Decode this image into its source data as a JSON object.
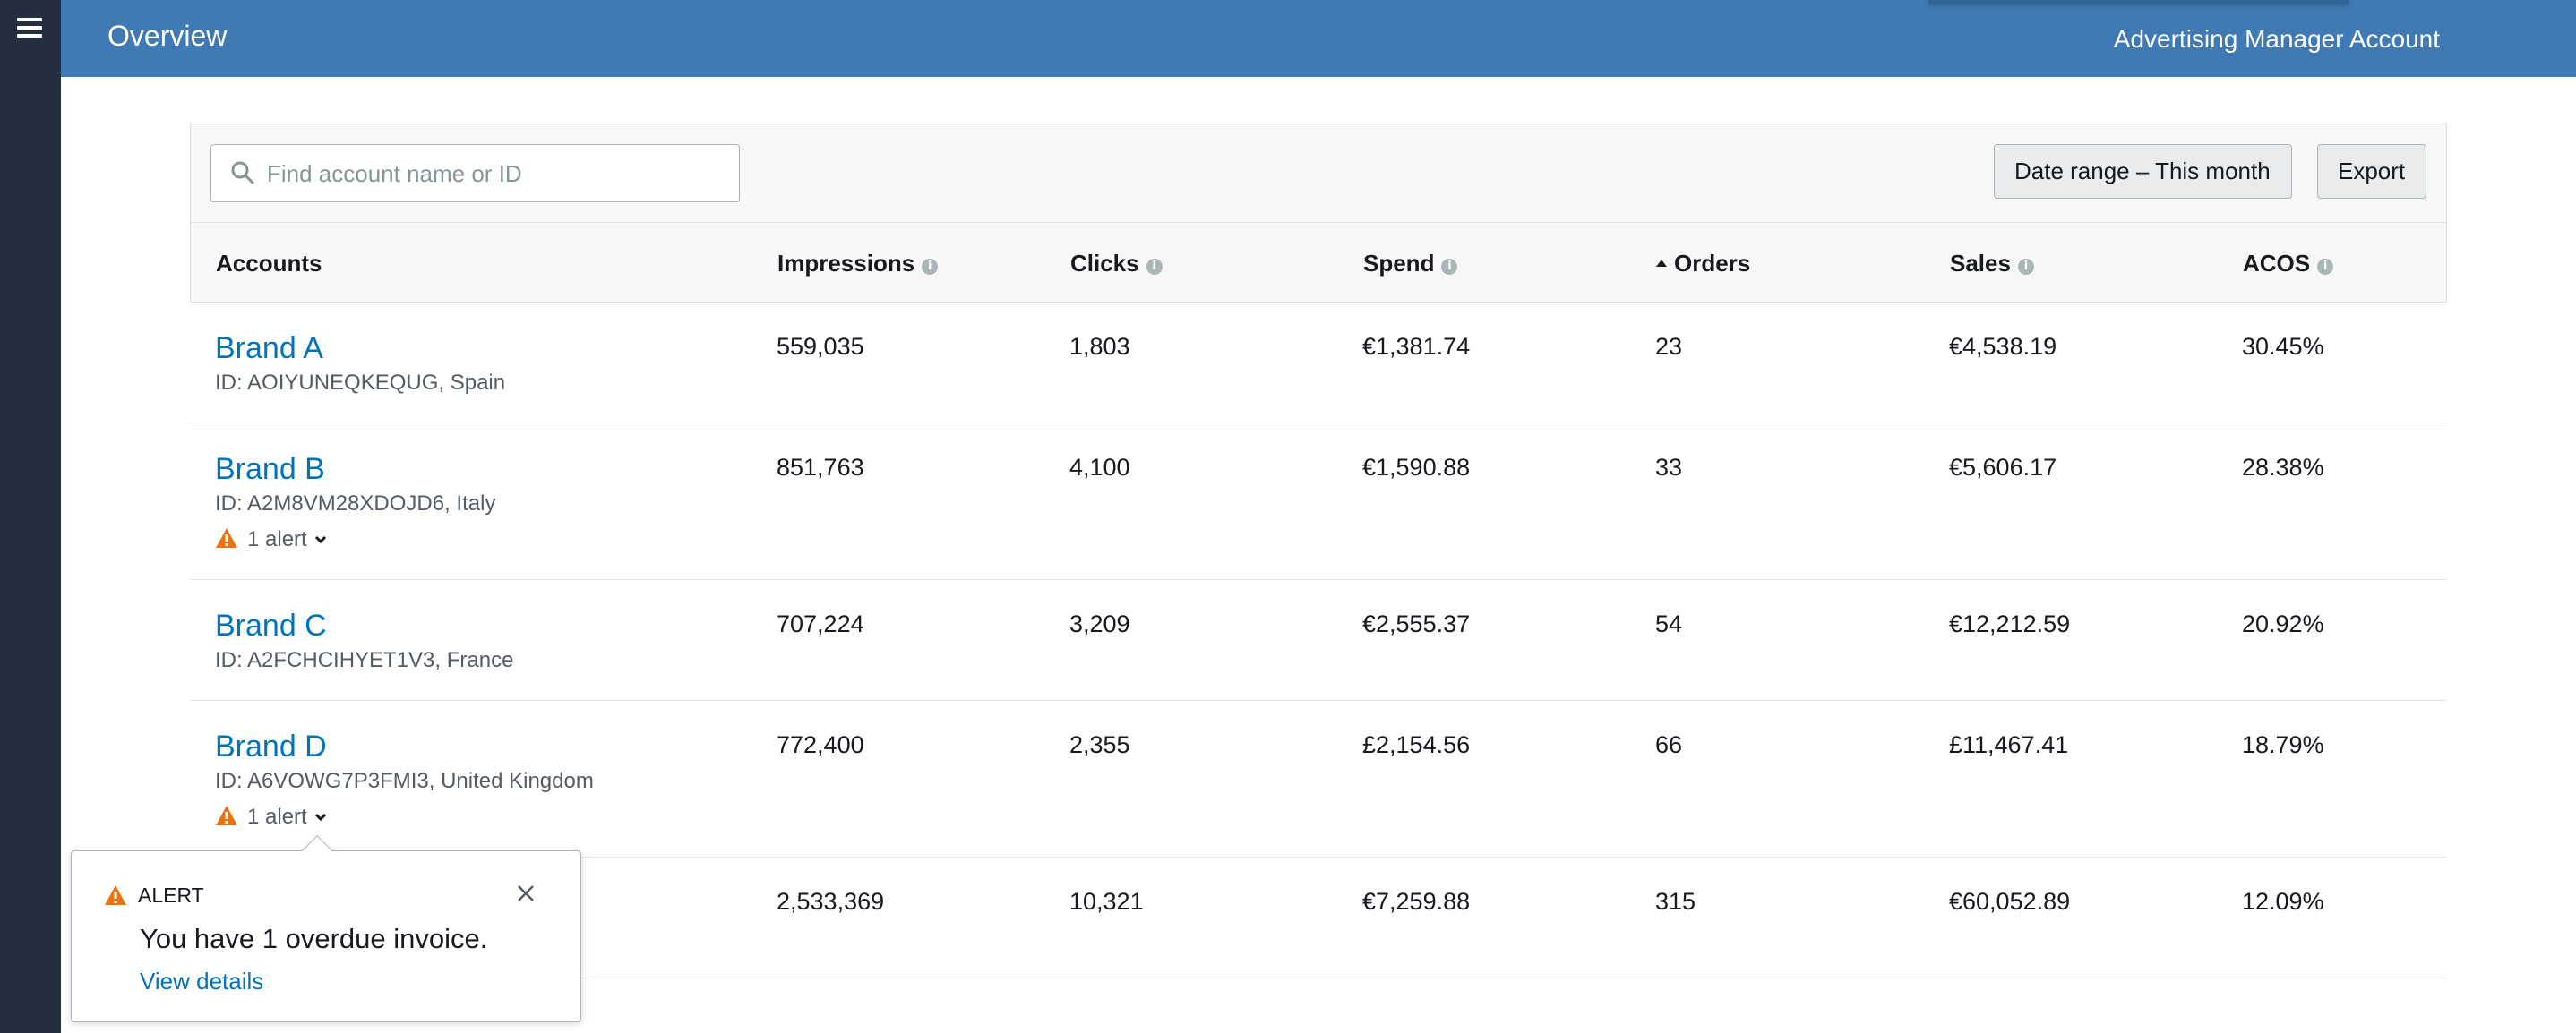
{
  "header": {
    "title": "Overview",
    "account_name": "Advertising Manager Account"
  },
  "search": {
    "placeholder": "Find account name or ID"
  },
  "toolbar": {
    "date_range_label": "Date range – This month",
    "export_label": "Export"
  },
  "table": {
    "columns": [
      {
        "label": "Accounts",
        "info": false,
        "sorted": false
      },
      {
        "label": "Impressions",
        "info": true,
        "sorted": false
      },
      {
        "label": "Clicks",
        "info": true,
        "sorted": false
      },
      {
        "label": "Spend",
        "info": true,
        "sorted": false
      },
      {
        "label": "Orders",
        "info": false,
        "sorted": true,
        "sort_direction": "ascending"
      },
      {
        "label": "Sales",
        "info": true,
        "sorted": false
      },
      {
        "label": "ACOS",
        "info": true,
        "sorted": false
      }
    ],
    "rows": [
      {
        "brand": "Brand A",
        "id_text": "ID: AOIYUNEQKEQUG, Spain",
        "alert": "",
        "impressions": "559,035",
        "clicks": "1,803",
        "spend": "€1,381.74",
        "orders": "23",
        "sales": "€4,538.19",
        "acos": "30.45%"
      },
      {
        "brand": "Brand B",
        "id_text": "ID: A2M8VM28XDOJD6, Italy",
        "alert": "1 alert",
        "impressions": "851,763",
        "clicks": "4,100",
        "spend": "€1,590.88",
        "orders": "33",
        "sales": "€5,606.17",
        "acos": "28.38%"
      },
      {
        "brand": "Brand C",
        "id_text": "ID: A2FCHCIHYET1V3, France",
        "alert": "",
        "impressions": "707,224",
        "clicks": "3,209",
        "spend": "€2,555.37",
        "orders": "54",
        "sales": "€12,212.59",
        "acos": "20.92%"
      },
      {
        "brand": "Brand D",
        "id_text": "ID: A6VOWG7P3FMI3, United Kingdom",
        "alert": "1 alert",
        "impressions": "772,400",
        "clicks": "2,355",
        "spend": "£2,154.56",
        "orders": "66",
        "sales": "£11,467.41",
        "acos": "18.79%"
      },
      {
        "brand": "",
        "id_text": "",
        "alert": "",
        "impressions": "2,533,369",
        "clicks": "10,321",
        "spend": "€7,259.88",
        "orders": "315",
        "sales": "€60,052.89",
        "acos": "12.09%"
      }
    ]
  },
  "popover": {
    "heading": "ALERT",
    "message": "You have 1 overdue invoice.",
    "link": "View details"
  },
  "colors": {
    "header_bg": "#3f7ab4",
    "rail_bg": "#232f3e",
    "link": "#0073bb",
    "warning": "#ec7211"
  }
}
